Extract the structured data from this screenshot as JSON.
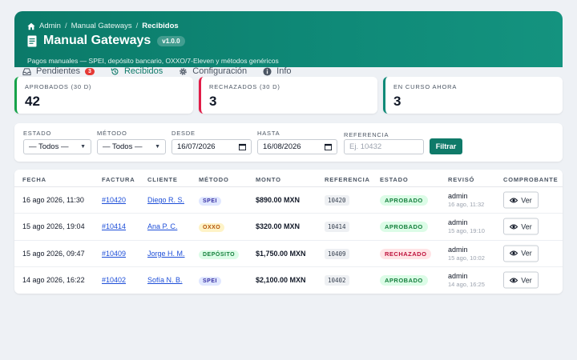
{
  "colors": {
    "brand": "#0f7a69",
    "approved": "#16a34a",
    "rejected": "#e11d48",
    "in_progress": "#0f8a78"
  },
  "breadcrumb": {
    "items": [
      "Admin",
      "Manual Gateways",
      "Recibidos"
    ]
  },
  "header": {
    "title": "Manual Gateways",
    "version": "v1.0.0",
    "subtitle": "Pagos manuales — SPEI, depósito bancario, OXXO/7‑Eleven y métodos genéricos"
  },
  "tabs": [
    {
      "label": "Pendientes",
      "badge": "3",
      "icon": "inbox-icon"
    },
    {
      "label": "Recibidos",
      "icon": "history-icon"
    },
    {
      "label": "Configuración",
      "icon": "gear-icon"
    },
    {
      "label": "Info",
      "icon": "info-icon"
    }
  ],
  "stats": [
    {
      "label": "APROBADOS (30 D)",
      "value": "42"
    },
    {
      "label": "RECHAZADOS (30 D)",
      "value": "3"
    },
    {
      "label": "EN CURSO AHORA",
      "value": "3"
    }
  ],
  "filters": {
    "estado_label": "ESTADO",
    "estado_value": "— Todos —",
    "metodo_label": "MÉTODO",
    "metodo_value": "— Todos —",
    "desde_label": "DESDE",
    "desde_value": "16/07/2026",
    "hasta_label": "HASTA",
    "hasta_value": "16/08/2026",
    "referencia_label": "REFERENCIA",
    "referencia_placeholder": "Ej. 10432",
    "button": "Filtrar"
  },
  "table": {
    "headers": [
      "FECHA",
      "FACTURA",
      "CLIENTE",
      "MÉTODO",
      "MONTO",
      "REFERENCIA",
      "ESTADO",
      "REVISÓ",
      "COMPROBANTE"
    ],
    "rows": [
      {
        "fecha": "16 ago 2026, 11:30",
        "factura": "#10420",
        "cliente": "Diego R. S.",
        "metodo": "SPEI",
        "monto": "$890.00 MXN",
        "referencia": "10420",
        "estado": "APROBADO",
        "reviso": "admin",
        "reviso_time": "16 ago, 11:32",
        "action": "Ver"
      },
      {
        "fecha": "15 ago 2026, 19:04",
        "factura": "#10414",
        "cliente": "Ana P. C.",
        "metodo": "OXXO",
        "monto": "$320.00 MXN",
        "referencia": "10414",
        "estado": "APROBADO",
        "reviso": "admin",
        "reviso_time": "15 ago, 19:10",
        "action": "Ver"
      },
      {
        "fecha": "15 ago 2026, 09:47",
        "factura": "#10409",
        "cliente": "Jorge H. M.",
        "metodo": "DEPÓSITO",
        "monto": "$1,750.00 MXN",
        "referencia": "10409",
        "estado": "RECHAZADO",
        "reviso": "admin",
        "reviso_time": "15 ago, 10:02",
        "action": "Ver"
      },
      {
        "fecha": "14 ago 2026, 16:22",
        "factura": "#10402",
        "cliente": "Sofía N. B.",
        "metodo": "SPEI",
        "monto": "$2,100.00 MXN",
        "referencia": "10402",
        "estado": "APROBADO",
        "reviso": "admin",
        "reviso_time": "14 ago, 16:25",
        "action": "Ver"
      }
    ]
  }
}
